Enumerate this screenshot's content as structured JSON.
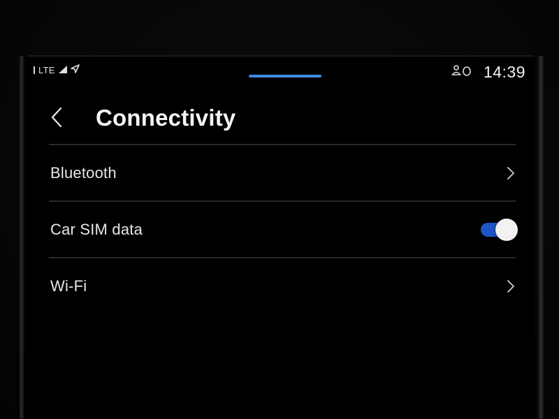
{
  "status_bar": {
    "network": "LTE",
    "clock": "14:39",
    "icons": [
      "sim-indicator-icon",
      "signal-icon",
      "location-arrow-icon",
      "user-profile-icon"
    ]
  },
  "header": {
    "title": "Connectivity",
    "back_icon": "chevron-left-icon"
  },
  "settings": {
    "items": [
      {
        "label": "Bluetooth",
        "control": "chevron-right-icon"
      },
      {
        "label": "Car SIM data",
        "control": "toggle",
        "toggle_on": true
      },
      {
        "label": "Wi-Fi",
        "control": "chevron-right-icon"
      }
    ]
  },
  "colors": {
    "background": "#000000",
    "accent": "#3d8be6",
    "toggle_on": "#1f55c6",
    "text": "#e6e6e6",
    "divider": "#2a2a2c"
  }
}
